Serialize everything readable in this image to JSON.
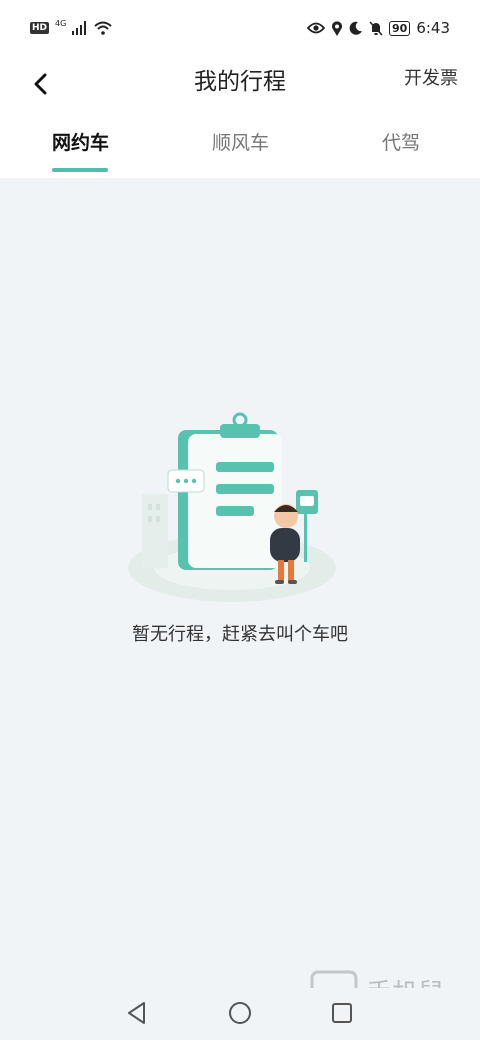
{
  "status_bar": {
    "network_badge": "HD",
    "network_type": "4G",
    "battery": "90",
    "time": "6:43"
  },
  "header": {
    "title": "我的行程",
    "invoice_label": "开发票"
  },
  "tabs": [
    {
      "label": "网约车",
      "active": true
    },
    {
      "label": "顺风车",
      "active": false
    },
    {
      "label": "代驾",
      "active": false
    }
  ],
  "empty_state": {
    "message": "暂无行程，赶紧去叫个车吧"
  },
  "colors": {
    "accent": "#4ac0ad",
    "background": "#f1f4f7"
  },
  "icons": {
    "back": "chevron-left-icon",
    "nav_back": "triangle-back-icon",
    "nav_home": "circle-home-icon",
    "nav_recent": "square-recent-icon"
  }
}
